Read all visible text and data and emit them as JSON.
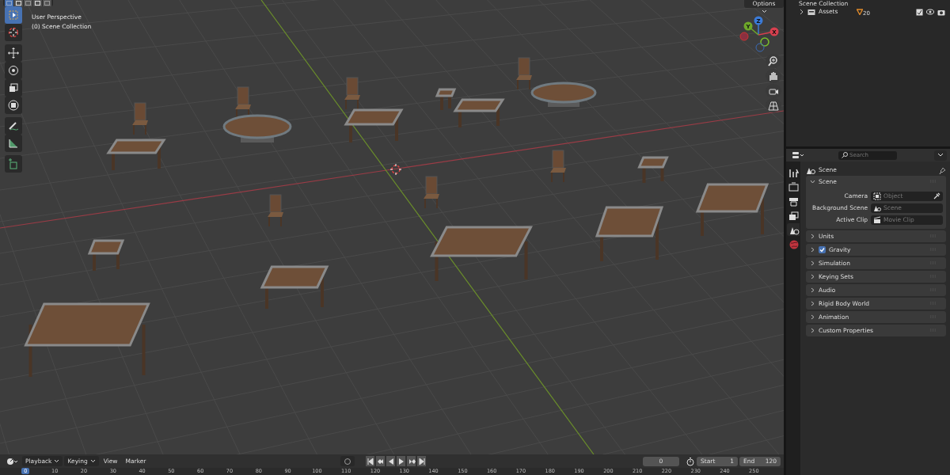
{
  "viewport": {
    "modes": [
      {
        "selected": true
      },
      {
        "selected": false
      },
      {
        "selected": false
      },
      {
        "selected": false
      },
      {
        "selected": false
      }
    ],
    "overlay_text": [
      "User Perspective",
      "(0) Scene Collection"
    ],
    "options": "Options",
    "tools": [
      {
        "selected": true
      },
      {
        "selected": false
      },
      {
        "selected": false
      },
      {
        "selected": false
      },
      {
        "selected": false
      },
      {
        "selected": false
      },
      {
        "selected": false
      },
      {
        "selected": false
      },
      {
        "selected": false
      }
    ],
    "gizmo_labels": {
      "z": "Z",
      "y": "Y",
      "x": "X"
    }
  },
  "outliner": {
    "title": "Scene Collection",
    "items": [
      {
        "name": "Assets",
        "expanded": false,
        "count": "20"
      }
    ]
  },
  "properties": {
    "search": {
      "placeholder": "Search"
    },
    "tabs": [
      {
        "selected": false
      },
      {
        "selected": false
      },
      {
        "selected": false
      },
      {
        "selected": false
      },
      {
        "selected": true
      },
      {
        "selected": false
      }
    ],
    "context": "Scene",
    "panels": [
      {
        "title": "Scene",
        "expanded": true,
        "fields": [
          {
            "label": "Camera",
            "placeholder": "Object"
          },
          {
            "label": "Background Scene",
            "placeholder": "Scene"
          },
          {
            "label": "Active Clip",
            "placeholder": "Movie Clip"
          }
        ]
      },
      {
        "title": "Units",
        "expanded": false
      },
      {
        "title": "Gravity",
        "expanded": false,
        "checked": true
      },
      {
        "title": "Simulation",
        "expanded": false
      },
      {
        "title": "Keying Sets",
        "expanded": false
      },
      {
        "title": "Audio",
        "expanded": false
      },
      {
        "title": "Rigid Body World",
        "expanded": false
      },
      {
        "title": "Animation",
        "expanded": false
      },
      {
        "title": "Custom Properties",
        "expanded": false
      }
    ]
  },
  "timeline": {
    "menus": [
      {
        "label": "Playback",
        "dropdown": true
      },
      {
        "label": "Keying",
        "dropdown": true
      },
      {
        "label": "View",
        "dropdown": false
      },
      {
        "label": "Marker",
        "dropdown": false
      }
    ],
    "current_frame": "0",
    "start_label": "Start",
    "start": "1",
    "end_label": "End",
    "end": "120",
    "ruler": [
      {
        "label": "0",
        "selected": true
      },
      {
        "label": "10",
        "selected": false
      },
      {
        "label": "20",
        "selected": false
      },
      {
        "label": "30",
        "selected": false
      },
      {
        "label": "40",
        "selected": false
      },
      {
        "label": "50",
        "selected": false
      },
      {
        "label": "60",
        "selected": false
      },
      {
        "label": "70",
        "selected": false
      },
      {
        "label": "80",
        "selected": false
      },
      {
        "label": "90",
        "selected": false
      },
      {
        "label": "100",
        "selected": false
      },
      {
        "label": "110",
        "selected": false
      },
      {
        "label": "120",
        "selected": false
      },
      {
        "label": "130",
        "selected": false
      },
      {
        "label": "140",
        "selected": false
      },
      {
        "label": "150",
        "selected": false
      },
      {
        "label": "160",
        "selected": false
      },
      {
        "label": "170",
        "selected": false
      },
      {
        "label": "180",
        "selected": false
      },
      {
        "label": "190",
        "selected": false
      },
      {
        "label": "200",
        "selected": false
      },
      {
        "label": "210",
        "selected": false
      },
      {
        "label": "220",
        "selected": false
      },
      {
        "label": "230",
        "selected": false
      },
      {
        "label": "240",
        "selected": false
      },
      {
        "label": "250",
        "selected": false
      }
    ]
  }
}
